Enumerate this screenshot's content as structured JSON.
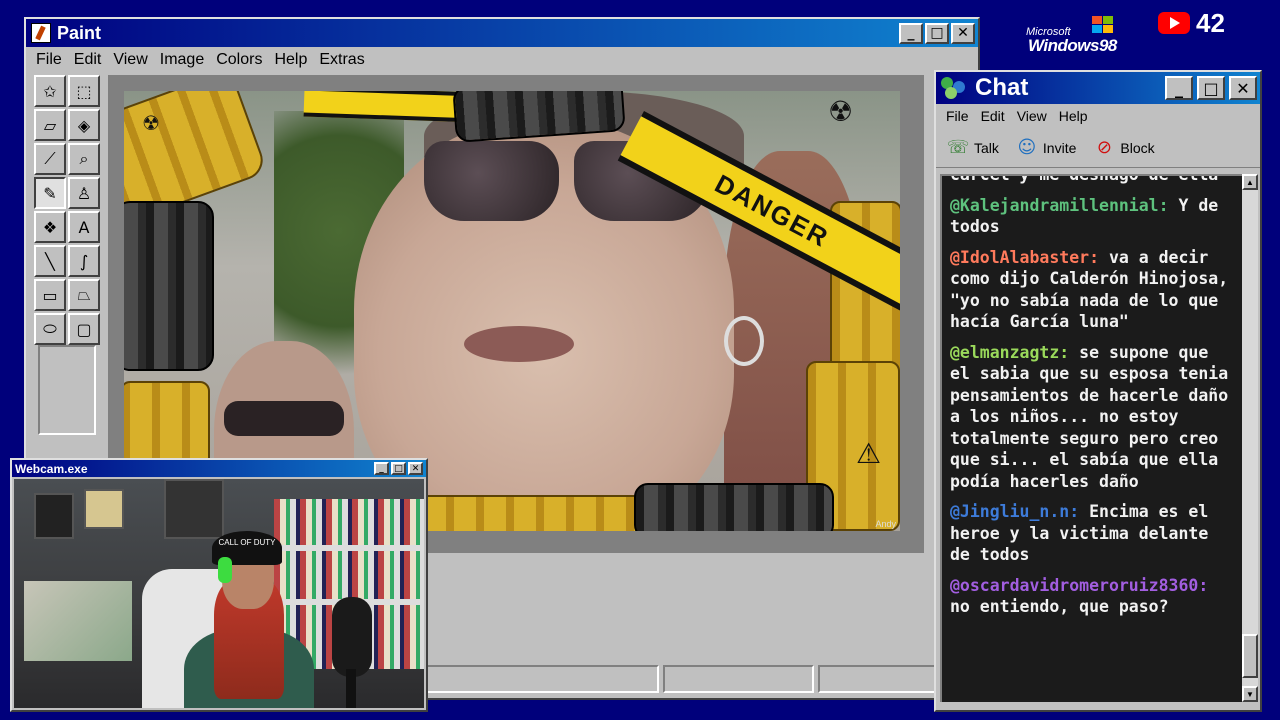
{
  "paint": {
    "title": "Paint",
    "menu": [
      "File",
      "Edit",
      "View",
      "Image",
      "Colors",
      "Help",
      "Extras"
    ],
    "tools": [
      {
        "name": "free-select-icon",
        "glyph": "✩"
      },
      {
        "name": "rect-select-icon",
        "glyph": "⬚"
      },
      {
        "name": "eraser-icon",
        "glyph": "▱"
      },
      {
        "name": "fill-icon",
        "glyph": "◈"
      },
      {
        "name": "color-picker-icon",
        "glyph": "⟋"
      },
      {
        "name": "magnifier-icon",
        "glyph": "⌕"
      },
      {
        "name": "pencil-icon",
        "glyph": "✎"
      },
      {
        "name": "brush-icon",
        "glyph": "♙"
      },
      {
        "name": "airbrush-icon",
        "glyph": "❖"
      },
      {
        "name": "text-icon",
        "glyph": "A"
      },
      {
        "name": "line-icon",
        "glyph": "╲"
      },
      {
        "name": "curve-icon",
        "glyph": "∫"
      },
      {
        "name": "rectangle-icon",
        "glyph": "▭"
      },
      {
        "name": "polygon-icon",
        "glyph": "⏢"
      },
      {
        "name": "ellipse-icon",
        "glyph": "⬭"
      },
      {
        "name": "rounded-rect-icon",
        "glyph": "▢"
      }
    ],
    "active_tool": "pencil-icon",
    "canvas": {
      "tape_text": "DANGER",
      "credit": "Andy"
    },
    "palette": [
      "#ff0000",
      "#ffff00",
      "#00ff00",
      "#00ffff",
      "#0000ff",
      "#ff00ff",
      "#ffff80",
      "#00ff80",
      "#80ffff",
      "#8080ff",
      "#ff0080",
      "#ff8040"
    ]
  },
  "branding": {
    "microsoft": "Microsoft",
    "windows": "Windows98",
    "youtube_count": "42",
    "flag_colors": [
      "#f35325",
      "#81bc06",
      "#05a6f0",
      "#ffba08"
    ]
  },
  "chat": {
    "title": "Chat",
    "menu": [
      "File",
      "Edit",
      "View",
      "Help"
    ],
    "toolbar": [
      {
        "label": "Talk",
        "icon": "talk-icon",
        "glyph": "☏",
        "color": "#2a7a2a"
      },
      {
        "label": "Invite",
        "icon": "invite-icon",
        "glyph": "☺",
        "color": "#1f6fbf"
      },
      {
        "label": "Block",
        "icon": "block-icon",
        "glyph": "⊘",
        "color": "#d01010"
      }
    ],
    "partial_top": "carcel y me deshago de ella",
    "messages": [
      {
        "user": "@Kalejandramillennial:",
        "color": "#5ec27e",
        "text": "Y de todos"
      },
      {
        "user": "@IdolAlabaster:",
        "color": "#ff7a5c",
        "text": "va a decir como dijo Calderón Hinojosa, \"yo no sabía nada de lo que hacía García luna\""
      },
      {
        "user": "@elmanzagtz:",
        "color": "#9ad95b",
        "text": "se supone que el sabia que su esposa tenia pensamientos de hacerle daño a los niños... no estoy totalmente seguro pero creo que si... el sabía que ella podía hacerles daño"
      },
      {
        "user": "@Jingliu_n.n:",
        "color": "#3d7bd9",
        "text": "Encima es el heroe y la victima delante de todos"
      },
      {
        "user": "@oscardavidromeroruiz8360:",
        "color": "#a25ee0",
        "text": "no entiendo, que paso?"
      }
    ]
  },
  "webcam": {
    "title": "Webcam.exe",
    "cap_text": "CALL OF DUTY"
  }
}
